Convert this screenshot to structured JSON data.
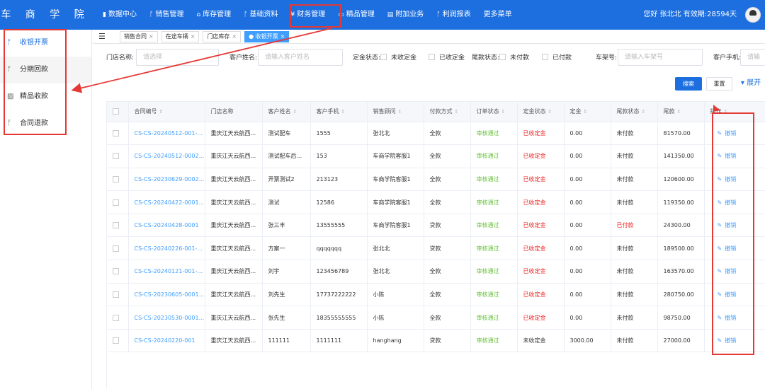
{
  "app": {
    "logo": "车 商 学 院"
  },
  "nav": [
    {
      "icon": "bar-chart-icon",
      "glyph": "▮",
      "label": "数据中心"
    },
    {
      "icon": "person-icon",
      "glyph": "ᚩ",
      "label": "销售管理"
    },
    {
      "icon": "store-icon",
      "glyph": "⌂",
      "label": "库存管理"
    },
    {
      "icon": "person-icon",
      "glyph": "ᚩ",
      "label": "基础资料"
    },
    {
      "icon": "yen-icon",
      "glyph": "¥",
      "label": "财务管理"
    },
    {
      "icon": "card-icon",
      "glyph": "▭",
      "label": "精品管理"
    },
    {
      "icon": "document-icon",
      "glyph": "▤",
      "label": "附加业务"
    },
    {
      "icon": "person-icon",
      "glyph": "ᚩ",
      "label": "利润报表"
    },
    {
      "icon": "",
      "glyph": "",
      "label": "更多菜单"
    }
  ],
  "user": {
    "text": "您好  张北北  有效期:28594天"
  },
  "sidebar": [
    {
      "label": "收银开票",
      "glyph": "ᚩ"
    },
    {
      "label": "分期回款",
      "glyph": "ᚩ"
    },
    {
      "label": "精品收款",
      "glyph": "▨"
    },
    {
      "label": "合同退款",
      "glyph": "ᚩ"
    }
  ],
  "tabs": [
    {
      "label": "销售合同"
    },
    {
      "label": "在途车辆"
    },
    {
      "label": "门店库存"
    },
    {
      "label": "● 收银开票"
    }
  ],
  "filters": {
    "store_label": "门店名称:",
    "store_placeholder": "请选择",
    "customer_label": "客户姓名:",
    "customer_placeholder": "请输入客户姓名",
    "deposit_label": "定金状态:",
    "deposit_opt1": "未收定金",
    "deposit_opt2": "已收定金",
    "final_label": "尾款状态:",
    "final_opt1": "未付款",
    "final_opt2": "已付款",
    "vin_label": "车架号:",
    "vin_placeholder": "请输入车架号",
    "phone_label": "客户手机:",
    "phone_placeholder": "请输"
  },
  "buttons": {
    "search": "搜索",
    "reset": "重置",
    "expand": "▾ 展开"
  },
  "table": {
    "columns": [
      "合同编号",
      "门店名称",
      "客户姓名",
      "客户手机",
      "销售顾问",
      "付款方式",
      "订单状态",
      "定金状态",
      "定金",
      "尾款状态",
      "尾款",
      "操作"
    ],
    "rows": [
      [
        "CS-CS-20240512-001-...",
        "重庆江天云航西...",
        "测试配车",
        "1555",
        "张北北",
        "全款",
        "审核通过",
        "已收定金",
        "0.00",
        "未付款",
        "81570.00",
        "撤销"
      ],
      [
        "CS-CS-20240512-0002...",
        "重庆江天云航西...",
        "测试配车后...",
        "153",
        "车商学院客服1",
        "全款",
        "审核通过",
        "已收定金",
        "0.00",
        "未付款",
        "141350.00",
        "撤销"
      ],
      [
        "CS-CS-20230629-0002...",
        "重庆江天云航西...",
        "开票测试2",
        "213123",
        "车商学院客服1",
        "全款",
        "审核通过",
        "已收定金",
        "0.00",
        "未付款",
        "120600.00",
        "撤销"
      ],
      [
        "CS-CS-20240422-0001...",
        "重庆江天云航西...",
        "测试",
        "12586",
        "车商学院客服1",
        "全款",
        "审核通过",
        "已收定金",
        "0.00",
        "未付款",
        "119350.00",
        "撤销"
      ],
      [
        "CS-CS-20240428-0001",
        "重庆江天云航西...",
        "张三丰",
        "13555555",
        "车商学院客服1",
        "贷款",
        "审核通过",
        "已收定金",
        "0.00",
        "已付款",
        "24300.00",
        "撤销"
      ],
      [
        "CS-CS-20240226-001-...",
        "重庆江天云航西...",
        "方案一",
        "qqqqqqq",
        "张北北",
        "贷款",
        "审核通过",
        "已收定金",
        "0.00",
        "未付款",
        "189500.00",
        "撤销"
      ],
      [
        "CS-CS-20240121-001-...",
        "重庆江天云航西...",
        "刘宇",
        "123456789",
        "张北北",
        "全款",
        "审核通过",
        "已收定金",
        "0.00",
        "未付款",
        "163570.00",
        "撤销"
      ],
      [
        "CS-CS-20230605-0001...",
        "重庆江天云航西...",
        "刘先生",
        "17737222222",
        "小陈",
        "全款",
        "审核通过",
        "已收定金",
        "0.00",
        "未付款",
        "280750.00",
        "撤销"
      ],
      [
        "CS-CS-20230530-0001...",
        "重庆江天云航西...",
        "张先生",
        "18355555555",
        "小陈",
        "全款",
        "审核通过",
        "已收定金",
        "0.00",
        "未付款",
        "98750.00",
        "撤销"
      ],
      [
        "CS-CS-20240220-001",
        "重庆江天云航西...",
        "111111",
        "1111111",
        "hanghang",
        "贷款",
        "审核通过",
        "未收定金",
        "3000.00",
        "未付款",
        "27000.00",
        "撤销"
      ]
    ]
  },
  "colors": {
    "primary": "#1d6fe0",
    "link": "#409eff",
    "success": "#67c23a",
    "danger": "#f02020",
    "annotation": "#e53935"
  }
}
